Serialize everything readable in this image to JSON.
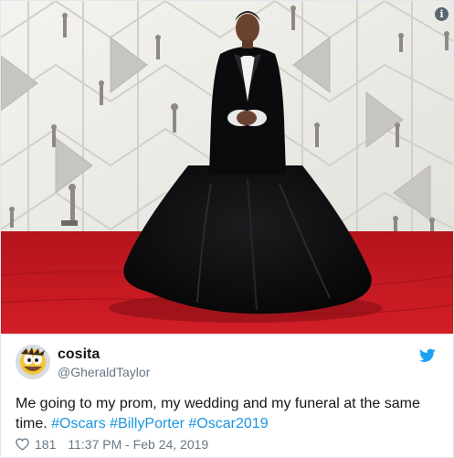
{
  "tweet": {
    "author": {
      "display_name": "cosita",
      "handle": "@GheraldTaylor"
    },
    "text_parts": [
      "Me going to my prom, my wedding and my funeral at the same time. ",
      "#Oscars",
      " ",
      "#BillyPorter",
      " ",
      "#Oscar2019"
    ],
    "likes": "181",
    "timestamp": "11:37 PM - Feb 24, 2019"
  },
  "info_icon": "i",
  "icons": {
    "info": "info-icon",
    "bird": "twitter-bird-icon",
    "heart": "heart-icon"
  },
  "colors": {
    "hashtag": "#1b95e0",
    "bird": "#1da1f2",
    "meta": "#657786",
    "carpet": "#c0171f"
  }
}
